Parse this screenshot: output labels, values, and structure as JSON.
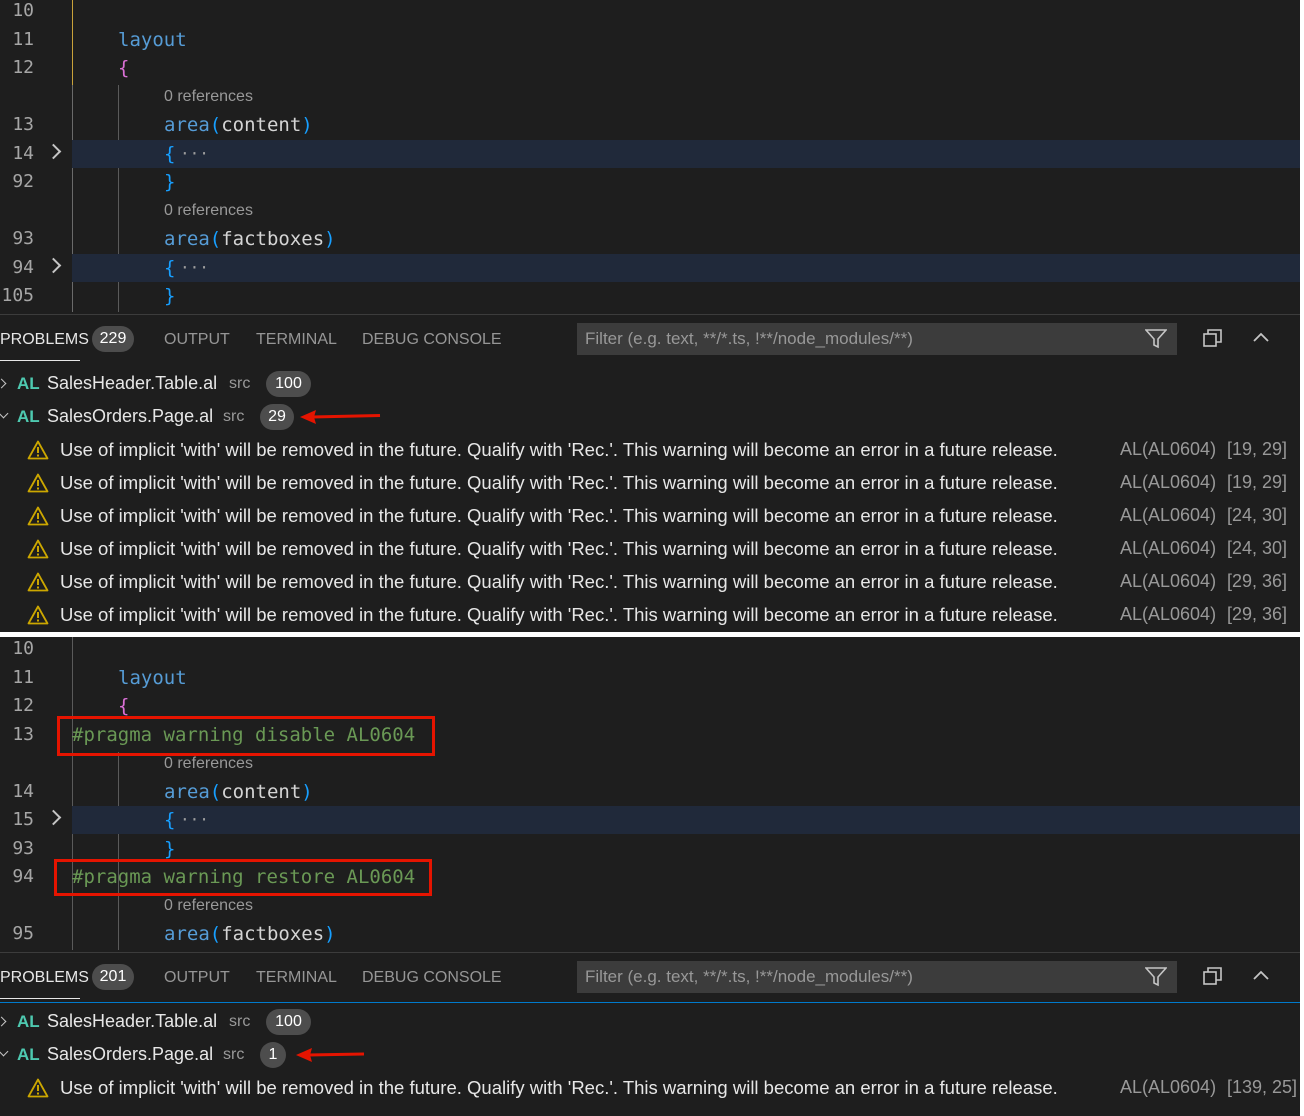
{
  "top": {
    "editor": {
      "lines": [
        {
          "num": "10",
          "kind": "blank"
        },
        {
          "num": "11",
          "kind": "kw",
          "text": "layout"
        },
        {
          "num": "12",
          "kind": "brace",
          "text": "{"
        },
        {
          "num": "",
          "kind": "lens",
          "text": "0 references"
        },
        {
          "num": "13",
          "kind": "area",
          "kw": "area",
          "open": "(",
          "arg": "content",
          "close": ")"
        },
        {
          "num": "14",
          "kind": "fold",
          "text": "{",
          "ellipsis": "···"
        },
        {
          "num": "92",
          "kind": "close",
          "text": "}"
        },
        {
          "num": "",
          "kind": "lens",
          "text": "0 references"
        },
        {
          "num": "93",
          "kind": "area",
          "kw": "area",
          "open": "(",
          "arg": "factboxes",
          "close": ")"
        },
        {
          "num": "94",
          "kind": "fold",
          "text": "{",
          "ellipsis": "···"
        },
        {
          "num": "105",
          "kind": "close",
          "text": "}"
        }
      ]
    },
    "panel": {
      "tabs": {
        "problems": "PROBLEMS",
        "output": "OUTPUT",
        "terminal": "TERMINAL",
        "debug": "DEBUG CONSOLE"
      },
      "problem_count": "229",
      "filter_placeholder": "Filter (e.g. text, **/*.ts, !**/node_modules/**)",
      "files": [
        {
          "icon": "AL",
          "name": "SalesHeader.Table.al",
          "dir": "src",
          "count": "100",
          "expanded": false
        },
        {
          "icon": "AL",
          "name": "SalesOrders.Page.al",
          "dir": "src",
          "count": "29",
          "expanded": true
        }
      ],
      "warnings": [
        {
          "message": "Use of implicit 'with' will be removed in the future. Qualify with 'Rec.'. This warning will become an error in a future release.",
          "code": "AL(AL0604)",
          "position": "[19, 29]"
        },
        {
          "message": "Use of implicit 'with' will be removed in the future. Qualify with 'Rec.'. This warning will become an error in a future release.",
          "code": "AL(AL0604)",
          "position": "[19, 29]"
        },
        {
          "message": "Use of implicit 'with' will be removed in the future. Qualify with 'Rec.'. This warning will become an error in a future release.",
          "code": "AL(AL0604)",
          "position": "[24, 30]"
        },
        {
          "message": "Use of implicit 'with' will be removed in the future. Qualify with 'Rec.'. This warning will become an error in a future release.",
          "code": "AL(AL0604)",
          "position": "[24, 30]"
        },
        {
          "message": "Use of implicit 'with' will be removed in the future. Qualify with 'Rec.'. This warning will become an error in a future release.",
          "code": "AL(AL0604)",
          "position": "[29, 36]"
        },
        {
          "message": "Use of implicit 'with' will be removed in the future. Qualify with 'Rec.'. This warning will become an error in a future release.",
          "code": "AL(AL0604)",
          "position": "[29, 36]"
        }
      ]
    }
  },
  "bottom": {
    "editor": {
      "lines": [
        {
          "num": "10",
          "kind": "blank"
        },
        {
          "num": "11",
          "kind": "kw",
          "text": "layout"
        },
        {
          "num": "12",
          "kind": "brace",
          "text": "{"
        },
        {
          "num": "13",
          "kind": "pragma",
          "text": "#pragma warning disable AL0604"
        },
        {
          "num": "",
          "kind": "lens",
          "text": "0 references"
        },
        {
          "num": "14",
          "kind": "area",
          "kw": "area",
          "open": "(",
          "arg": "content",
          "close": ")"
        },
        {
          "num": "15",
          "kind": "fold",
          "text": "{",
          "ellipsis": "···"
        },
        {
          "num": "93",
          "kind": "close",
          "text": "}"
        },
        {
          "num": "94",
          "kind": "pragma",
          "text": "#pragma warning restore AL0604"
        },
        {
          "num": "",
          "kind": "lens",
          "text": "0 references"
        },
        {
          "num": "95",
          "kind": "area",
          "kw": "area",
          "open": "(",
          "arg": "factboxes",
          "close": ")"
        }
      ]
    },
    "panel": {
      "tabs": {
        "problems": "PROBLEMS",
        "output": "OUTPUT",
        "terminal": "TERMINAL",
        "debug": "DEBUG CONSOLE"
      },
      "problem_count": "201",
      "filter_placeholder": "Filter (e.g. text, **/*.ts, !**/node_modules/**)",
      "files": [
        {
          "icon": "AL",
          "name": "SalesHeader.Table.al",
          "dir": "src",
          "count": "100",
          "expanded": false
        },
        {
          "icon": "AL",
          "name": "SalesOrders.Page.al",
          "dir": "src",
          "count": "1",
          "expanded": true
        }
      ],
      "warnings": [
        {
          "message": "Use of implicit 'with' will be removed in the future. Qualify with 'Rec.'. This warning will become an error in a future release.",
          "code": "AL(AL0604)",
          "position": "[139, 25]"
        }
      ]
    }
  },
  "colors": {
    "annotation_red": "#e51400",
    "warning_yellow": "#cca700",
    "pragma_green": "#6a9955"
  },
  "icons": [
    "chevron-right-icon",
    "filter-icon",
    "collapse-all-icon",
    "chevron-up-icon",
    "warning-icon",
    "arrow-annotation"
  ]
}
